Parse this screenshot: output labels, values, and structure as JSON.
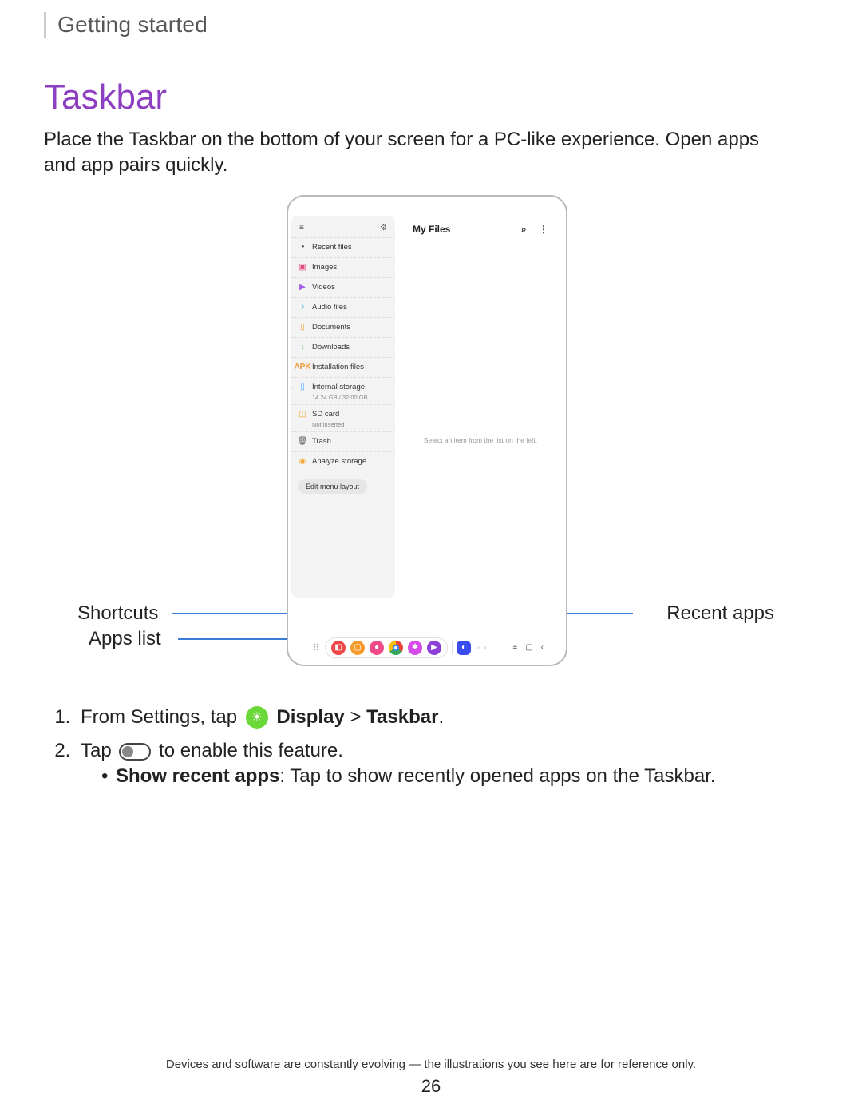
{
  "breadcrumb": "Getting started",
  "title": "Taskbar",
  "intro": "Place the Taskbar on the bottom of your screen for a PC-like experience. Open apps and app pairs quickly.",
  "device": {
    "main_title": "My Files",
    "main_hint": "Select an item from the list on the left.",
    "sidebar_items": [
      "Recent files",
      "Images",
      "Videos",
      "Audio files",
      "Documents",
      "Downloads",
      "Installation files",
      "Internal storage",
      "SD card",
      "Trash",
      "Analyze storage"
    ],
    "storage_sub": "14.24 GB / 32.00 GB",
    "sd_sub": "Not inserted",
    "edit_button": "Edit menu layout"
  },
  "callouts": {
    "shortcuts": "Shortcuts",
    "apps_list": "Apps list",
    "recent": "Recent apps"
  },
  "steps": {
    "s1_prefix": "From Settings, tap ",
    "s1_display": "Display",
    "s1_sep": " > ",
    "s1_taskbar": "Taskbar",
    "s1_end": ".",
    "s2_prefix": "Tap ",
    "s2_suffix": " to enable this feature.",
    "bullet_label": "Show recent apps",
    "bullet_rest": ": Tap to show recently opened apps on the Taskbar."
  },
  "footer": "Devices and software are constantly evolving — the illustrations you see here are for reference only.",
  "page_number": "26"
}
